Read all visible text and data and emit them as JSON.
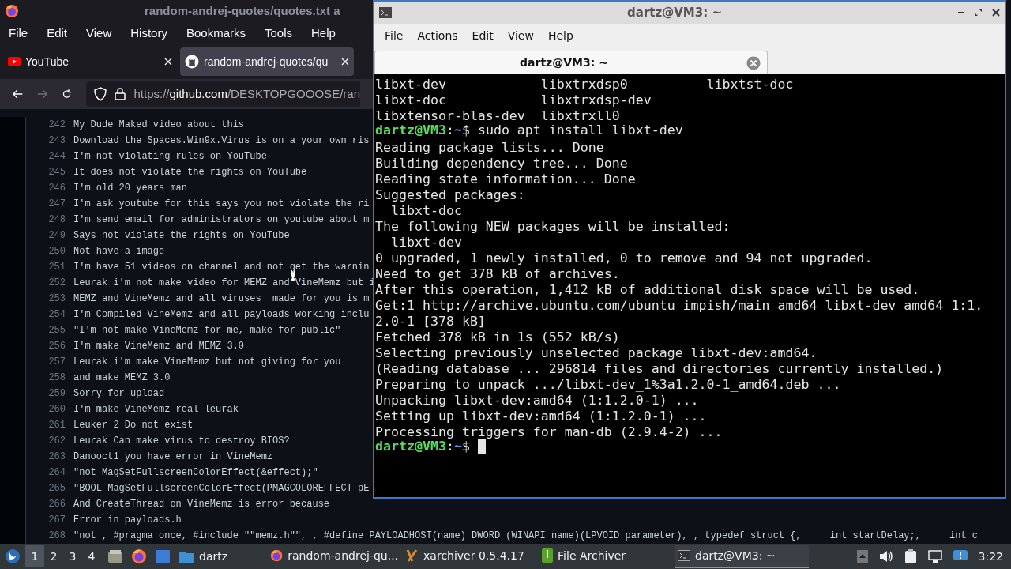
{
  "browser": {
    "title": "random-andrej-quotes/quotes.txt a",
    "menu": [
      "File",
      "Edit",
      "View",
      "History",
      "Bookmarks",
      "Tools",
      "Help"
    ],
    "tabs": [
      {
        "label": "YouTube",
        "kind": "youtube",
        "selected": false
      },
      {
        "label": "random-andrej-quotes/qu",
        "kind": "github",
        "selected": true
      }
    ],
    "url": {
      "scheme": "https://",
      "host": "github.com",
      "path": "/DESKTOPGOOOSE/ran"
    },
    "lines": [
      {
        "number": "242",
        "text": "My Dude Maked video about this"
      },
      {
        "number": "243",
        "text": "Download the Spaces.Win9x.Virus is on a your own ris"
      },
      {
        "number": "244",
        "text": "I'm not violating rules on YouTube"
      },
      {
        "number": "245",
        "text": "It does not violate the rights on YouTube"
      },
      {
        "number": "246",
        "text": "I'm old 20 years man"
      },
      {
        "number": "247",
        "text": "I'm ask youtube for this says you not violate the ri"
      },
      {
        "number": "248",
        "text": "I'm send email for administrators on youtube about m"
      },
      {
        "number": "249",
        "text": "Says not violate the rights on YouTube"
      },
      {
        "number": "250",
        "text": "Not have a image"
      },
      {
        "number": "251",
        "text": "I'm have 51 videos on channel and not get the warnin"
      },
      {
        "number": "252",
        "text": "Leurak i'm not make video for MEMZ and VineMemz but i"
      },
      {
        "number": "253",
        "text": "MEMZ and VineMemz and all viruses  made for you is m"
      },
      {
        "number": "254",
        "text": "I'm Compiled VineMemz and all payloads working inclu"
      },
      {
        "number": "255",
        "text": "\"I'm not make VineMemz for me, make for public\""
      },
      {
        "number": "256",
        "text": "I'm make VineMemz and MEMZ 3.0"
      },
      {
        "number": "257",
        "text": "Leurak i'm make VineMemz but not giving for you"
      },
      {
        "number": "258",
        "text": "and make MEMZ 3.0"
      },
      {
        "number": "259",
        "text": "Sorry for upload"
      },
      {
        "number": "260",
        "text": "I'm make VineMemz real leurak"
      },
      {
        "number": "261",
        "text": "Leuker 2 Do not exist"
      },
      {
        "number": "262",
        "text": "Leurak Can make virus to destroy BIOS?"
      },
      {
        "number": "263",
        "text": "Danooct1 you have error in VineMemz"
      },
      {
        "number": "264",
        "text": "\"not MagSetFullscreenColorEffect(&effect);\""
      },
      {
        "number": "265",
        "text": "\"BOOL MagSetFullscreenColorEffect(PMAGCOLOREFFECT pE"
      },
      {
        "number": "266",
        "text": "And CreateThread on VineMemz is error because"
      },
      {
        "number": "267",
        "text": "Error in payloads.h"
      },
      {
        "number": "268",
        "text": "\"not , #pragma once, #include \"\"memz.h\"\", , #define PAYLOADHOST(name) DWORD (WINAPI name)(LPVOID parameter), , typedef struct {,     int startDelay;,     int c"
      }
    ]
  },
  "terminal": {
    "title": "dartz@VM3: ~",
    "menu": [
      "File",
      "Actions",
      "Edit",
      "View",
      "Help"
    ],
    "tab": {
      "label": "dartz@VM3: ~"
    },
    "lines": [
      {
        "kind": "output",
        "text": "libxt-dev            libxtrxdsp0          libxtst-doc"
      },
      {
        "kind": "output",
        "text": "libxt-doc            libxtrxdsp-dev"
      },
      {
        "kind": "output",
        "text": "libxtensor-blas-dev  libxtrxll0"
      },
      {
        "kind": "prompt",
        "user": "dartz@VM3",
        "sep": ":",
        "dir": "~",
        "sign": "$",
        "command": "sudo apt install libxt-dev"
      },
      {
        "kind": "output",
        "text": "Reading package lists... Done"
      },
      {
        "kind": "output",
        "text": "Building dependency tree... Done"
      },
      {
        "kind": "output",
        "text": "Reading state information... Done"
      },
      {
        "kind": "output",
        "text": "Suggested packages:"
      },
      {
        "kind": "output",
        "text": "  libxt-doc"
      },
      {
        "kind": "output",
        "text": "The following NEW packages will be installed:"
      },
      {
        "kind": "output",
        "text": "  libxt-dev"
      },
      {
        "kind": "output",
        "text": "0 upgraded, 1 newly installed, 0 to remove and 94 not upgraded."
      },
      {
        "kind": "output",
        "text": "Need to get 378 kB of archives."
      },
      {
        "kind": "output",
        "text": "After this operation, 1,412 kB of additional disk space will be used."
      },
      {
        "kind": "output",
        "text": "Get:1 http://archive.ubuntu.com/ubuntu impish/main amd64 libxt-dev amd64 1:1."
      },
      {
        "kind": "output",
        "text": "2.0-1 [378 kB]"
      },
      {
        "kind": "output",
        "text": "Fetched 378 kB in 1s (552 kB/s)"
      },
      {
        "kind": "output",
        "text": "Selecting previously unselected package libxt-dev:amd64."
      },
      {
        "kind": "output",
        "text": "(Reading database ... 296814 files and directories currently installed.)"
      },
      {
        "kind": "output",
        "text": "Preparing to unpack .../libxt-dev_1%3a1.2.0-1_amd64.deb ..."
      },
      {
        "kind": "output",
        "text": "Unpacking libxt-dev:amd64 (1:1.2.0-1) ..."
      },
      {
        "kind": "output",
        "text": "Setting up libxt-dev:amd64 (1:1.2.0-1) ..."
      },
      {
        "kind": "output",
        "text": "Processing triggers for man-db (2.9.4-2) ..."
      },
      {
        "kind": "prompt",
        "user": "dartz@VM3",
        "sep": ":",
        "dir": "~",
        "sign": "$",
        "cursor": true
      }
    ]
  },
  "taskbar": {
    "workspaces": [
      {
        "label": "1",
        "selected": true
      },
      {
        "label": "2",
        "selected": false
      },
      {
        "label": "3",
        "selected": false
      },
      {
        "label": "4",
        "selected": false
      }
    ],
    "folder": "dartz",
    "tasks": [
      {
        "label": "random-andrej-qu...",
        "kind": "firefox",
        "selected": false
      },
      {
        "label": "xarchiver 0.5.4.17",
        "kind": "xarchiver",
        "selected": false
      },
      {
        "label": "File Archiver",
        "kind": "archive",
        "selected": false
      },
      {
        "label": "dartz@VM3: ~",
        "kind": "terminal",
        "selected": true
      }
    ],
    "clock": "3:22"
  }
}
